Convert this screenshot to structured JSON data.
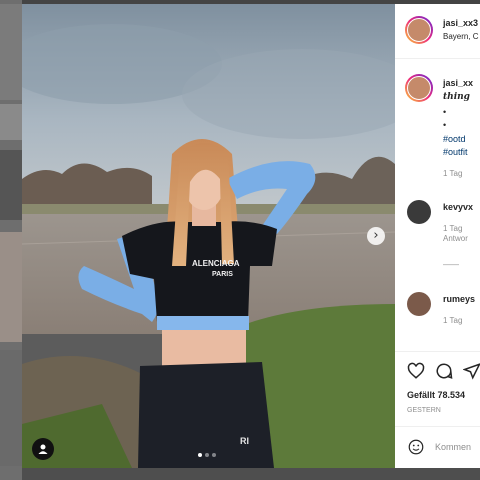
{
  "post": {
    "author": "jasi_xx3",
    "location": "Bayern, C"
  },
  "caption": {
    "author": "jasi_xx",
    "text": "thing",
    "bullet1": "•",
    "bullet2": "•",
    "tag1": "#ootd",
    "tag2": "#outfit",
    "age": "1 Tag"
  },
  "comments": [
    {
      "author": "kevyvx",
      "age": "1 Tag",
      "reply": "Antwor"
    },
    {
      "author": "rumeys",
      "age": "1 Tag"
    }
  ],
  "view_replies": "——",
  "actions": {
    "likes": "Gefällt 78.534",
    "date": "GESTERN",
    "comment_placeholder": "Kommen"
  },
  "photo": {
    "shirt_text_1": "ALENCIAGA",
    "shirt_text_2": "PARIS",
    "pants_logo": "RI"
  },
  "carousel": {
    "slides": 3,
    "active": 1
  },
  "colors": {
    "link": "#00376b",
    "muted": "#8e8e8e",
    "text": "#262626"
  }
}
